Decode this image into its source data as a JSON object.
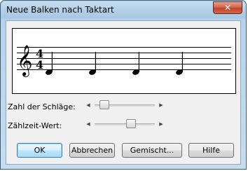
{
  "window": {
    "title": "Neue Balken nach Taktart",
    "close_glyph": "✕"
  },
  "preview": {
    "clef_glyph": "𝄞",
    "time_signature_top": "4",
    "time_signature_bottom": "4",
    "notes_count": 4
  },
  "controls": {
    "beats_label": "Zahl der Schläge:",
    "beat_value_label": "Zählzeit-Wert:",
    "beats_slider_level": 0.12,
    "beat_value_slider_level": 0.62
  },
  "buttons": {
    "ok": "OK",
    "cancel": "Abbrechen",
    "mixed": "Gemischt...",
    "help": "Hilfe"
  }
}
